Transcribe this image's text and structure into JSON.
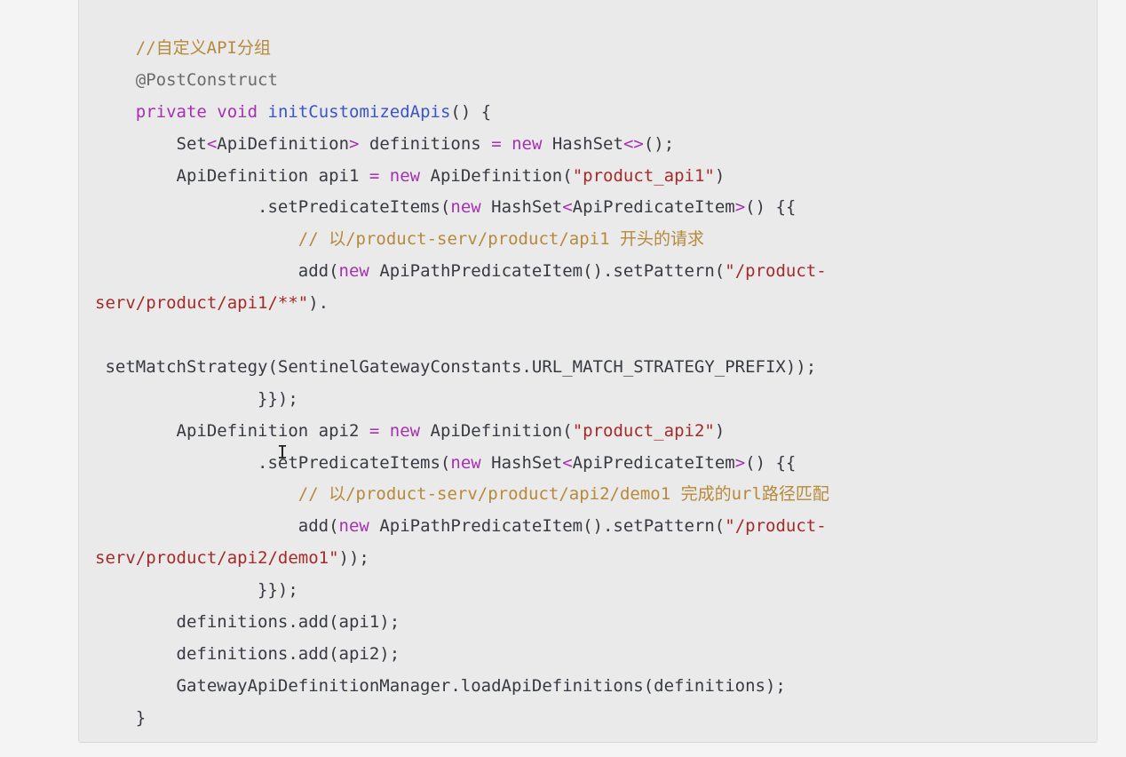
{
  "code_block": {
    "lines": [
      [
        {
          "t": "    "
        },
        {
          "t": "//自定义API分组",
          "c": "comment"
        }
      ],
      [
        {
          "t": "    "
        },
        {
          "t": "@PostConstruct",
          "c": "annotation"
        }
      ],
      [
        {
          "t": "    "
        },
        {
          "t": "private",
          "c": "keyword"
        },
        {
          "t": " "
        },
        {
          "t": "void",
          "c": "keyword"
        },
        {
          "t": " "
        },
        {
          "t": "initCustomizedApis",
          "c": "func"
        },
        {
          "t": "() {"
        }
      ],
      [
        {
          "t": "        Set"
        },
        {
          "t": "<",
          "c": "keyword"
        },
        {
          "t": "ApiDefinition"
        },
        {
          "t": ">",
          "c": "keyword"
        },
        {
          "t": " definitions "
        },
        {
          "t": "=",
          "c": "keyword"
        },
        {
          "t": " "
        },
        {
          "t": "new",
          "c": "keyword"
        },
        {
          "t": " HashSet"
        },
        {
          "t": "<>",
          "c": "keyword"
        },
        {
          "t": "();"
        }
      ],
      [
        {
          "t": "        ApiDefinition api1 "
        },
        {
          "t": "=",
          "c": "keyword"
        },
        {
          "t": " "
        },
        {
          "t": "new",
          "c": "keyword"
        },
        {
          "t": " ApiDefinition("
        },
        {
          "t": "\"product_api1\"",
          "c": "string"
        },
        {
          "t": ")"
        }
      ],
      [
        {
          "t": "                .setPredicateItems("
        },
        {
          "t": "new",
          "c": "keyword"
        },
        {
          "t": " HashSet"
        },
        {
          "t": "<",
          "c": "keyword"
        },
        {
          "t": "ApiPredicateItem"
        },
        {
          "t": ">",
          "c": "keyword"
        },
        {
          "t": "() {{"
        }
      ],
      [
        {
          "t": "                    "
        },
        {
          "t": "// 以/product-serv/product/api1 开头的请求",
          "c": "comment"
        }
      ],
      [
        {
          "t": "                    add("
        },
        {
          "t": "new",
          "c": "keyword"
        },
        {
          "t": " ApiPathPredicateItem().setPattern("
        },
        {
          "t": "\"/product-",
          "c": "string"
        }
      ],
      [
        {
          "t": "serv/product/api1/**\"",
          "c": "string"
        },
        {
          "t": ")."
        }
      ],
      [
        {
          "t": ""
        }
      ],
      [
        {
          "t": " setMatchStrategy(SentinelGatewayConstants.URL_MATCH_STRATEGY_PREFIX));"
        }
      ],
      [
        {
          "t": "                }});"
        }
      ],
      [
        {
          "t": "        ApiDefinition api2 "
        },
        {
          "t": "=",
          "c": "keyword"
        },
        {
          "t": " "
        },
        {
          "t": "new",
          "c": "keyword"
        },
        {
          "t": " ApiDefinition("
        },
        {
          "t": "\"product_api2\"",
          "c": "string"
        },
        {
          "t": ")"
        }
      ],
      [
        {
          "t": "                .setPredicateItems("
        },
        {
          "t": "new",
          "c": "keyword"
        },
        {
          "t": " HashSet"
        },
        {
          "t": "<",
          "c": "keyword"
        },
        {
          "t": "ApiPredicateItem"
        },
        {
          "t": ">",
          "c": "keyword"
        },
        {
          "t": "() {{"
        }
      ],
      [
        {
          "t": "                    "
        },
        {
          "t": "// 以/product-serv/product/api2/demo1 完成的url路径匹配",
          "c": "comment"
        }
      ],
      [
        {
          "t": "                    add("
        },
        {
          "t": "new",
          "c": "keyword"
        },
        {
          "t": " ApiPathPredicateItem().setPattern("
        },
        {
          "t": "\"/product-",
          "c": "string"
        }
      ],
      [
        {
          "t": "serv/product/api2/demo1\"",
          "c": "string"
        },
        {
          "t": "));"
        }
      ],
      [
        {
          "t": "                }});"
        }
      ],
      [
        {
          "t": "        definitions.add(api1);"
        }
      ],
      [
        {
          "t": "        definitions.add(api2);"
        }
      ],
      [
        {
          "t": "        GatewayApiDefinitionManager.loadApiDefinitions(definitions);"
        }
      ],
      [
        {
          "t": "    }"
        }
      ]
    ]
  },
  "cursor_glyph": "I"
}
